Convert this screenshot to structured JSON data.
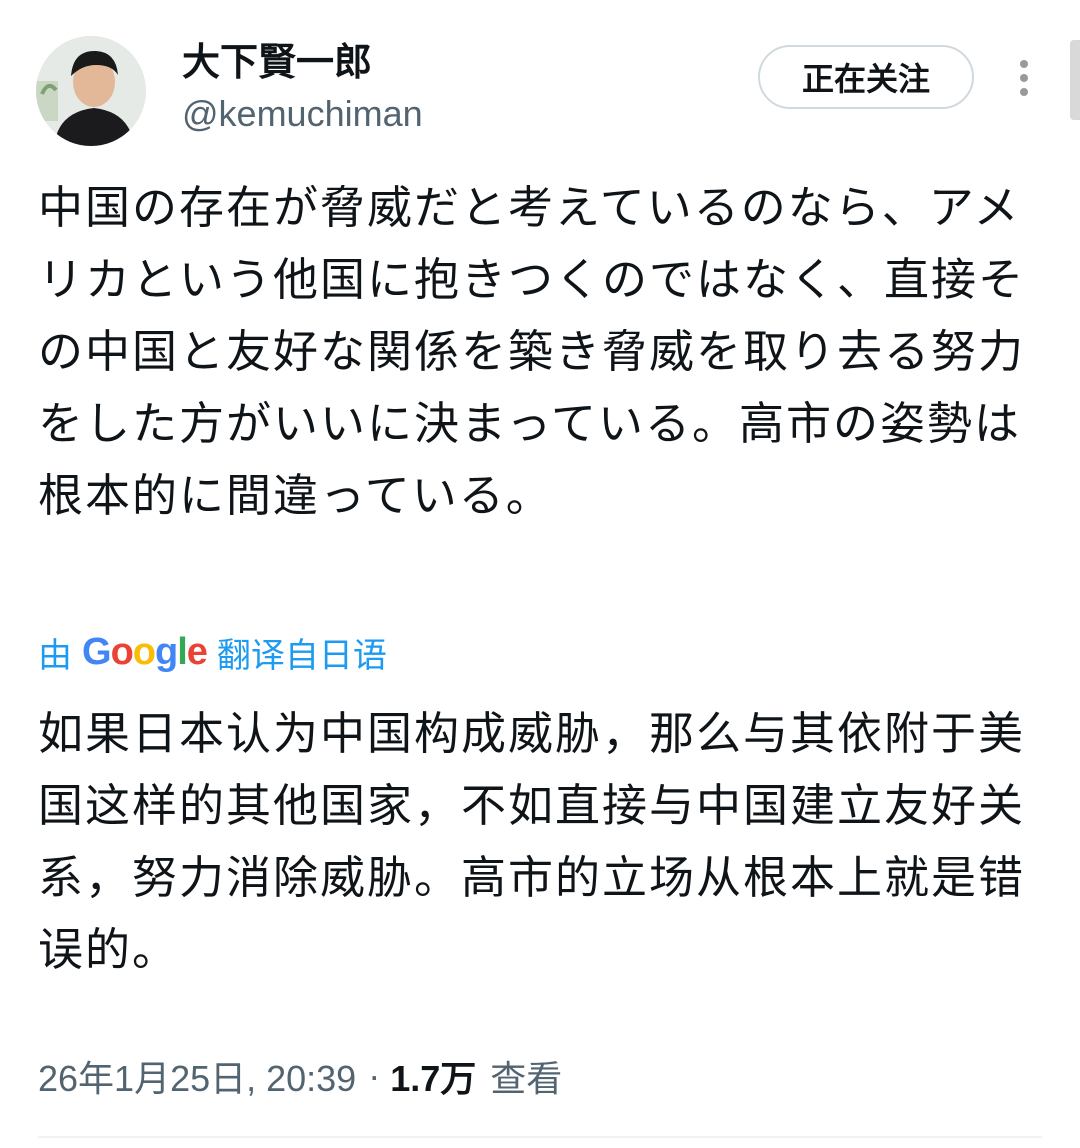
{
  "author": {
    "display_name": "大下賢一郎",
    "handle": "@kemuchiman"
  },
  "follow_button_label": "正在关注",
  "more_icon": "more-vertical-icon",
  "tweet": {
    "text": "中国の存在が脅威だと考えているのなら、アメリカという他国に抱きつくのではなく、直接その中国と友好な関係を築き脅威を取り去る努力をした方がいいに決まっている。高市の姿勢は根本的に間違っている。"
  },
  "translation": {
    "prefix": "由",
    "provider": "Google",
    "suffix": "翻译自日语",
    "text": "如果日本认为中国构成威胁，那么与其依附于美国这样的其他国家，不如直接与中国建立友好关系，努力消除威胁。高市的立场从根本上就是错误的。"
  },
  "meta": {
    "timestamp": "26年1月25日, 20:39",
    "separator": "·",
    "views_count": "1.7万",
    "views_label": "查看"
  },
  "colors": {
    "primary_text": "#0f1419",
    "secondary_text": "#536471",
    "link_blue": "#1d9bf0",
    "button_border": "#cfd9de",
    "google_blue": "#4285F4",
    "google_red": "#EA4335",
    "google_yellow": "#FBBC05",
    "google_green": "#34A853"
  }
}
